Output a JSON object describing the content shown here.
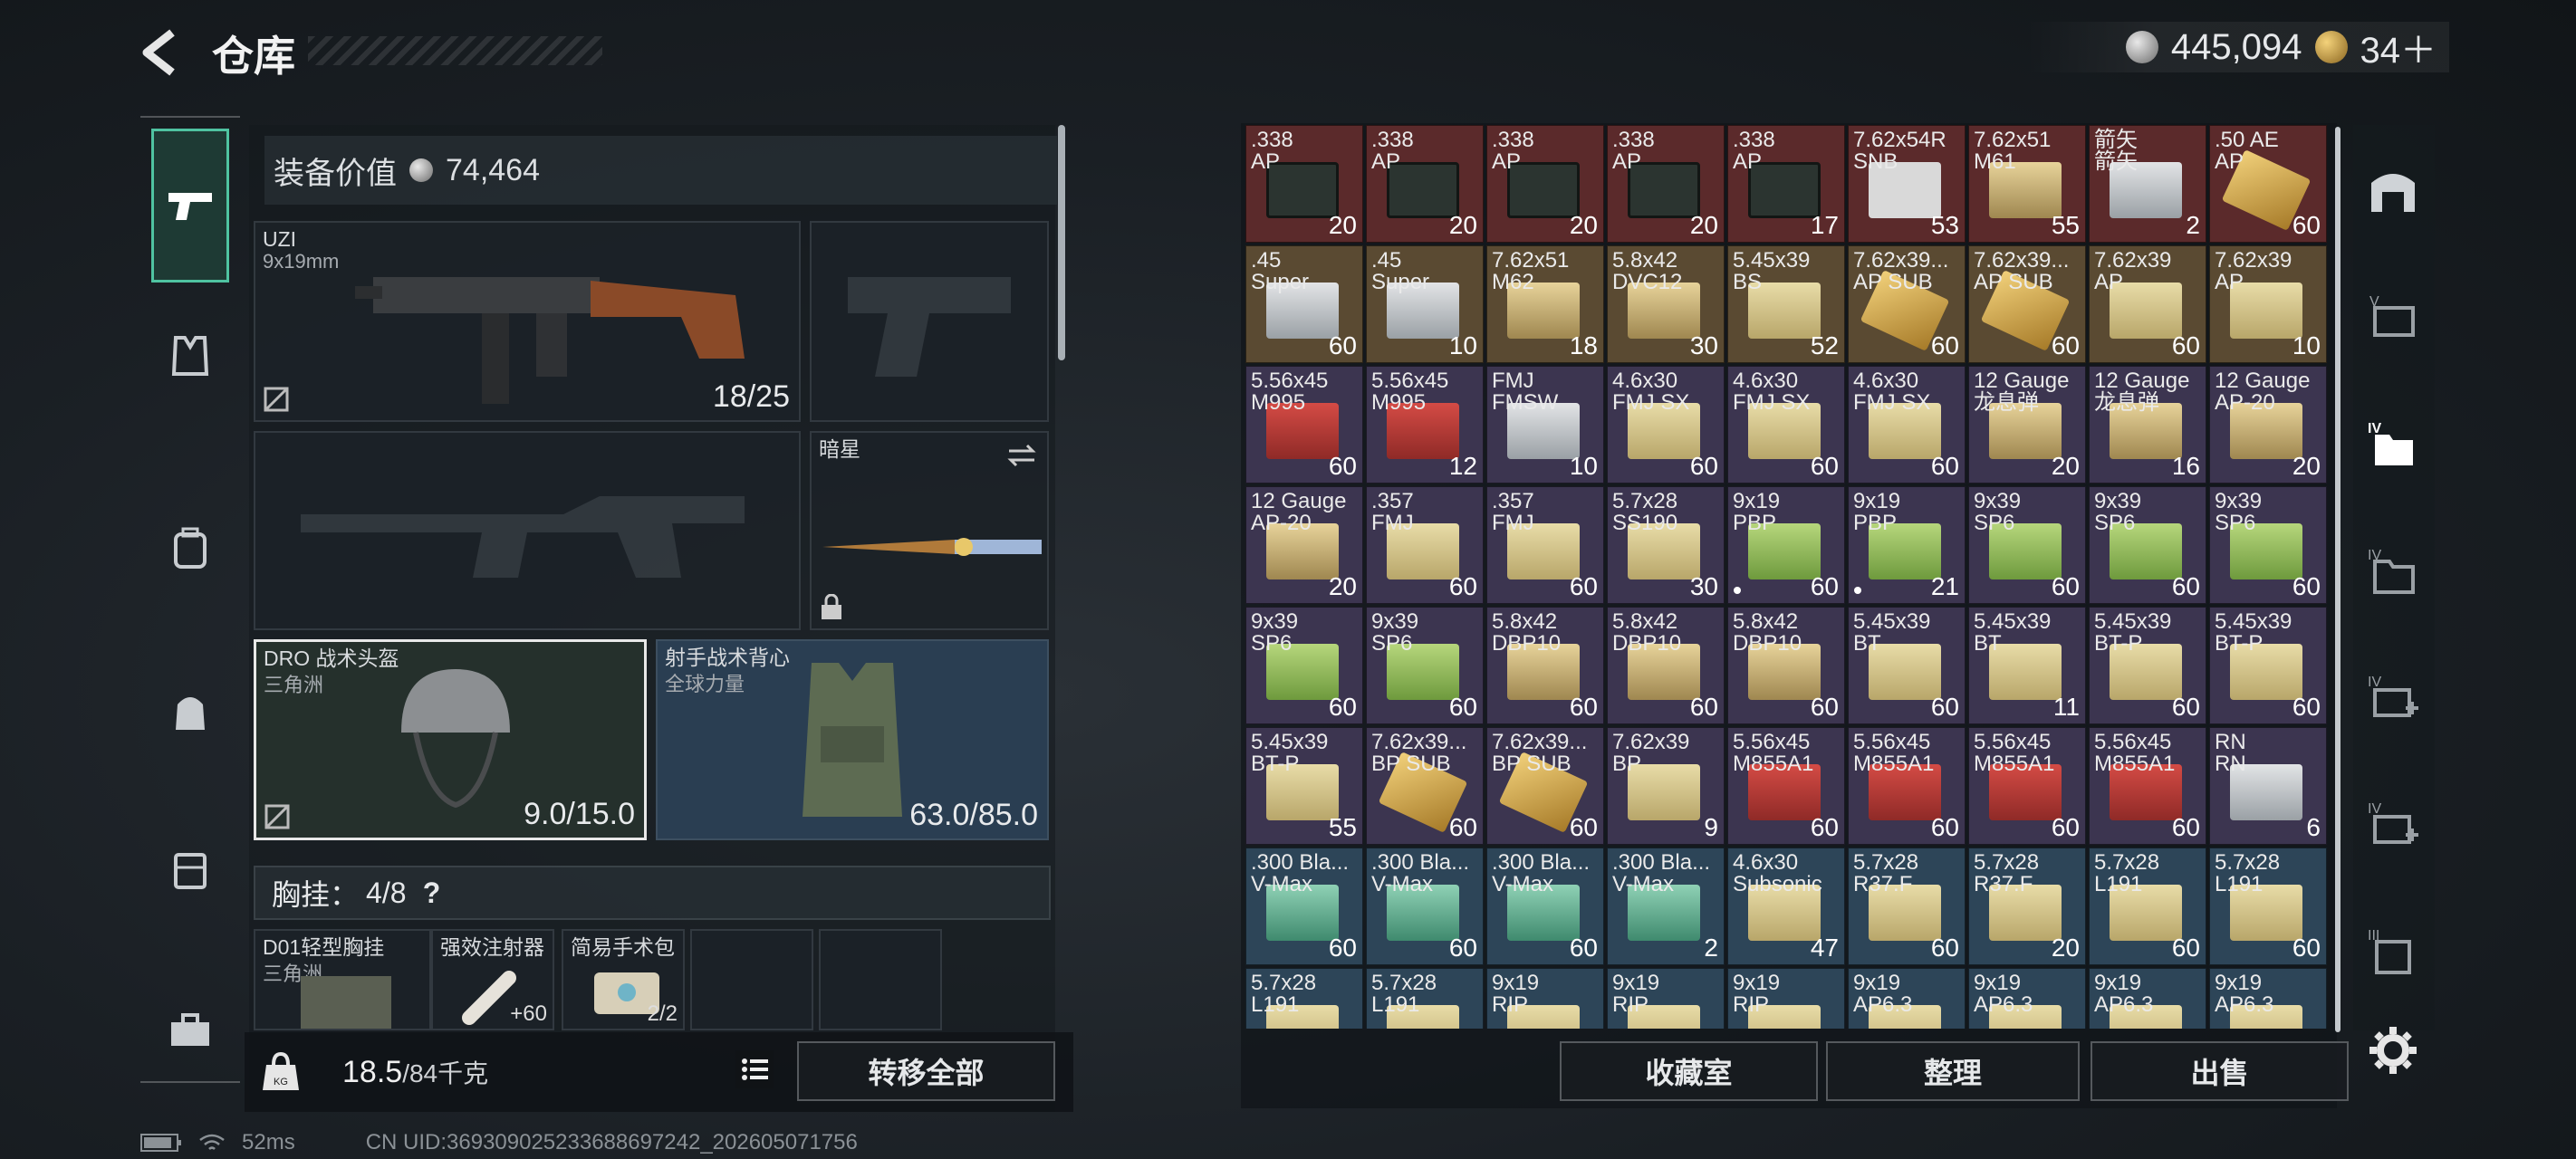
{
  "header": {
    "title": "仓库",
    "silver_amount": "445,094",
    "gold_amount": "34＋"
  },
  "equip": {
    "value_label": "装备价值",
    "value_amount": "74,464"
  },
  "slots": {
    "primary": {
      "name": "UZI",
      "sub": "9x19mm",
      "ammo": "18/25"
    },
    "melee": {
      "name": "暗星"
    },
    "helmet": {
      "name": "DRO 战术头盔",
      "sub": "三角洲",
      "durability": "9.0/15.0"
    },
    "armor": {
      "name": "射手战术背心",
      "sub": "全球力量",
      "durability": "63.0/85.0"
    }
  },
  "rig": {
    "label": "胸挂：",
    "count": "4/8",
    "help": "?",
    "items": [
      {
        "name": "D01轻型胸挂",
        "sub": "三角洲"
      },
      {
        "name": "强效注射器",
        "extra": "+60"
      },
      {
        "name": "简易手术包",
        "extra": "2/2"
      }
    ]
  },
  "bottom": {
    "weight": "18.5",
    "weight_max": "/84千克",
    "transfer_all": "转移全部"
  },
  "status": {
    "ping": "52ms",
    "uid": "CN UID:369309025233688697242_202605071756"
  },
  "actions": {
    "collection": "收藏室",
    "sort": "整理",
    "sell": "出售"
  },
  "inventory": [
    {
      "n1": ".338",
      "n2": "AP",
      "c": "20",
      "bg": "r-red",
      "box": "b-mil"
    },
    {
      "n1": ".338",
      "n2": "AP",
      "c": "20",
      "bg": "r-red",
      "box": "b-mil"
    },
    {
      "n1": ".338",
      "n2": "AP",
      "c": "20",
      "bg": "r-red",
      "box": "b-mil"
    },
    {
      "n1": ".338",
      "n2": "AP",
      "c": "20",
      "bg": "r-red",
      "box": "b-mil"
    },
    {
      "n1": ".338",
      "n2": "AP",
      "c": "17",
      "bg": "r-red",
      "box": "b-mil"
    },
    {
      "n1": "7.62x54R",
      "n2": "SNB",
      "c": "53",
      "bg": "r-red",
      "box": "b-white"
    },
    {
      "n1": "7.62x51",
      "n2": "M61",
      "c": "55",
      "bg": "r-red",
      "box": "b-sand"
    },
    {
      "n1": "箭矢",
      "n2": "箭矢",
      "c": "2",
      "bg": "r-red",
      "box": "b-silver"
    },
    {
      "n1": ".50 AE",
      "n2": "AP",
      "c": "60",
      "bg": "r-red",
      "box": "b-brass"
    },
    {
      "n1": ".45",
      "n2": "Super",
      "c": "60",
      "bg": "r-gold",
      "box": "b-silver"
    },
    {
      "n1": ".45",
      "n2": "Super",
      "c": "10",
      "bg": "r-gold",
      "box": "b-silver"
    },
    {
      "n1": "7.62x51",
      "n2": "M62",
      "c": "18",
      "bg": "r-gold",
      "box": "b-sand"
    },
    {
      "n1": "5.8x42",
      "n2": "DVC12",
      "c": "30",
      "bg": "r-gold",
      "box": "b-sand"
    },
    {
      "n1": "5.45x39",
      "n2": "BS",
      "c": "52",
      "bg": "r-gold",
      "box": "b-tan"
    },
    {
      "n1": "7.62x39...",
      "n2": "AP SUB",
      "c": "60",
      "bg": "r-gold",
      "box": "b-brass"
    },
    {
      "n1": "7.62x39...",
      "n2": "AP SUB",
      "c": "60",
      "bg": "r-gold",
      "box": "b-brass"
    },
    {
      "n1": "7.62x39",
      "n2": "AP",
      "c": "60",
      "bg": "r-gold",
      "box": "b-tan"
    },
    {
      "n1": "7.62x39",
      "n2": "AP",
      "c": "10",
      "bg": "r-gold",
      "box": "b-tan"
    },
    {
      "n1": "5.56x45",
      "n2": "M995",
      "c": "60",
      "bg": "r-purple",
      "box": "b-red"
    },
    {
      "n1": "5.56x45",
      "n2": "M995",
      "c": "12",
      "bg": "r-purple",
      "box": "b-red"
    },
    {
      "n1": "FMJ",
      "n2": "FMSW",
      "c": "10",
      "bg": "r-purple",
      "box": "b-silver"
    },
    {
      "n1": "4.6x30",
      "n2": "FMJ SX",
      "c": "60",
      "bg": "r-purple",
      "box": "b-tan"
    },
    {
      "n1": "4.6x30",
      "n2": "FMJ SX",
      "c": "60",
      "bg": "r-purple",
      "box": "b-tan"
    },
    {
      "n1": "4.6x30",
      "n2": "FMJ SX",
      "c": "60",
      "bg": "r-purple",
      "box": "b-tan"
    },
    {
      "n1": "12 Gauge",
      "n2": "龙息弹",
      "c": "20",
      "bg": "r-purple",
      "box": "b-sand"
    },
    {
      "n1": "12 Gauge",
      "n2": "龙息弹",
      "c": "16",
      "bg": "r-purple",
      "box": "b-sand"
    },
    {
      "n1": "12 Gauge",
      "n2": "AP-20",
      "c": "20",
      "bg": "r-purple",
      "box": "b-sand"
    },
    {
      "n1": "12 Gauge",
      "n2": "AP-20",
      "c": "20",
      "bg": "r-purple",
      "box": "b-sand"
    },
    {
      "n1": ".357",
      "n2": "FMJ",
      "c": "60",
      "bg": "r-purple",
      "box": "b-tan"
    },
    {
      "n1": ".357",
      "n2": "FMJ",
      "c": "60",
      "bg": "r-purple",
      "box": "b-tan"
    },
    {
      "n1": "5.7x28",
      "n2": "SS190",
      "c": "30",
      "bg": "r-purple",
      "box": "b-tan"
    },
    {
      "n1": "9x19",
      "n2": "PBP",
      "c": "60",
      "bg": "r-purple",
      "box": "b-green",
      "dot": true
    },
    {
      "n1": "9x19",
      "n2": "PBP",
      "c": "21",
      "bg": "r-purple",
      "box": "b-green",
      "dot": true
    },
    {
      "n1": "9x39",
      "n2": "SP6",
      "c": "60",
      "bg": "r-purple",
      "box": "b-green"
    },
    {
      "n1": "9x39",
      "n2": "SP6",
      "c": "60",
      "bg": "r-purple",
      "box": "b-green"
    },
    {
      "n1": "9x39",
      "n2": "SP6",
      "c": "60",
      "bg": "r-purple",
      "box": "b-green"
    },
    {
      "n1": "9x39",
      "n2": "SP6",
      "c": "60",
      "bg": "r-purple",
      "box": "b-green"
    },
    {
      "n1": "9x39",
      "n2": "SP6",
      "c": "60",
      "bg": "r-purple",
      "box": "b-green"
    },
    {
      "n1": "5.8x42",
      "n2": "DBP10",
      "c": "60",
      "bg": "r-purple",
      "box": "b-sand"
    },
    {
      "n1": "5.8x42",
      "n2": "DBP10",
      "c": "60",
      "bg": "r-purple",
      "box": "b-sand"
    },
    {
      "n1": "5.8x42",
      "n2": "DBP10",
      "c": "60",
      "bg": "r-purple",
      "box": "b-sand"
    },
    {
      "n1": "5.45x39",
      "n2": "BT",
      "c": "60",
      "bg": "r-purple",
      "box": "b-tan"
    },
    {
      "n1": "5.45x39",
      "n2": "BT",
      "c": "11",
      "bg": "r-purple",
      "box": "b-tan"
    },
    {
      "n1": "5.45x39",
      "n2": "BT-P",
      "c": "60",
      "bg": "r-purple",
      "box": "b-tan"
    },
    {
      "n1": "5.45x39",
      "n2": "BT-P",
      "c": "60",
      "bg": "r-purple",
      "box": "b-tan"
    },
    {
      "n1": "5.45x39",
      "n2": "BT-P",
      "c": "55",
      "bg": "r-purple",
      "box": "b-tan"
    },
    {
      "n1": "7.62x39...",
      "n2": "BP SUB",
      "c": "60",
      "bg": "r-purple",
      "box": "b-brass"
    },
    {
      "n1": "7.62x39...",
      "n2": "BP SUB",
      "c": "60",
      "bg": "r-purple",
      "box": "b-brass"
    },
    {
      "n1": "7.62x39",
      "n2": "BP",
      "c": "9",
      "bg": "r-purple",
      "box": "b-tan"
    },
    {
      "n1": "5.56x45",
      "n2": "M855A1",
      "c": "60",
      "bg": "r-purple",
      "box": "b-red"
    },
    {
      "n1": "5.56x45",
      "n2": "M855A1",
      "c": "60",
      "bg": "r-purple",
      "box": "b-red"
    },
    {
      "n1": "5.56x45",
      "n2": "M855A1",
      "c": "60",
      "bg": "r-purple",
      "box": "b-red"
    },
    {
      "n1": "5.56x45",
      "n2": "M855A1",
      "c": "60",
      "bg": "r-purple",
      "box": "b-red"
    },
    {
      "n1": "RN",
      "n2": "RN",
      "c": "6",
      "bg": "r-purple",
      "box": "b-silver"
    },
    {
      "n1": ".300 Bla...",
      "n2": "V-Max",
      "c": "60",
      "bg": "r-blue",
      "box": "b-teal"
    },
    {
      "n1": ".300 Bla...",
      "n2": "V-Max",
      "c": "60",
      "bg": "r-blue",
      "box": "b-teal"
    },
    {
      "n1": ".300 Bla...",
      "n2": "V-Max",
      "c": "60",
      "bg": "r-blue",
      "box": "b-teal"
    },
    {
      "n1": ".300 Bla...",
      "n2": "V-Max",
      "c": "2",
      "bg": "r-blue",
      "box": "b-teal"
    },
    {
      "n1": "4.6x30",
      "n2": "Subsonic",
      "c": "47",
      "bg": "r-blue",
      "box": "b-tan"
    },
    {
      "n1": "5.7x28",
      "n2": "R37.F",
      "c": "60",
      "bg": "r-blue",
      "box": "b-tan"
    },
    {
      "n1": "5.7x28",
      "n2": "R37.F",
      "c": "20",
      "bg": "r-blue",
      "box": "b-tan"
    },
    {
      "n1": "5.7x28",
      "n2": "L191",
      "c": "60",
      "bg": "r-blue",
      "box": "b-tan"
    },
    {
      "n1": "5.7x28",
      "n2": "L191",
      "c": "60",
      "bg": "r-blue",
      "box": "b-tan"
    },
    {
      "n1": "5.7x28",
      "n2": "L191",
      "c": "",
      "bg": "r-blue",
      "box": "b-tan"
    },
    {
      "n1": "5.7x28",
      "n2": "L191",
      "c": "",
      "bg": "r-blue",
      "box": "b-tan"
    },
    {
      "n1": "9x19",
      "n2": "RIP",
      "c": "",
      "bg": "r-blue",
      "box": "b-tan"
    },
    {
      "n1": "9x19",
      "n2": "RIP",
      "c": "",
      "bg": "r-blue",
      "box": "b-tan"
    },
    {
      "n1": "9x19",
      "n2": "RIP",
      "c": "",
      "bg": "r-blue",
      "box": "b-tan"
    },
    {
      "n1": "9x19",
      "n2": "AP6.3",
      "c": "",
      "bg": "r-blue",
      "box": "b-tan"
    },
    {
      "n1": "9x19",
      "n2": "AP6.3",
      "c": "",
      "bg": "r-blue",
      "box": "b-tan"
    },
    {
      "n1": "9x19",
      "n2": "AP6.3",
      "c": "",
      "bg": "r-blue",
      "box": "b-tan"
    },
    {
      "n1": "9x19",
      "n2": "AP6.3",
      "c": "",
      "bg": "r-blue",
      "box": "b-tan"
    }
  ]
}
